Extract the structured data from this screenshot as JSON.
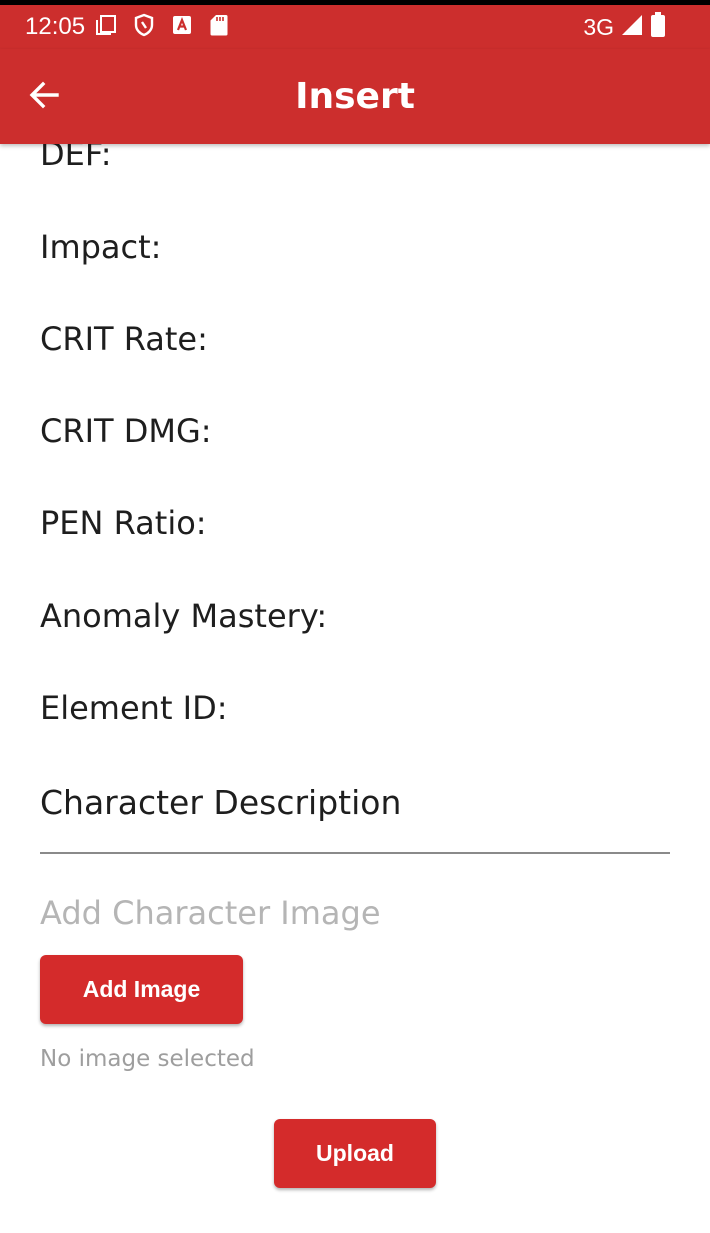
{
  "status_bar": {
    "time": "12:05",
    "network": "3G",
    "left_icons": [
      "screen-icon",
      "shield-icon",
      "a-icon",
      "sd-card-icon"
    ],
    "right_icons": [
      "signal-icon",
      "battery-icon"
    ]
  },
  "app_bar": {
    "title": "Insert",
    "back_icon": "arrow-left-icon",
    "color": "#cc2e2d"
  },
  "form": {
    "fields": [
      "DEF:",
      "Impact:",
      "CRIT Rate:",
      "CRIT DMG:",
      "PEN Ratio:",
      "Anomaly Mastery:",
      "Element ID:"
    ],
    "description_label": "Character Description",
    "image_hint": "Add Character Image",
    "add_image_label": "Add Image",
    "no_image_text": "No image selected",
    "upload_label": "Upload",
    "button_color": "#d42b2b"
  }
}
